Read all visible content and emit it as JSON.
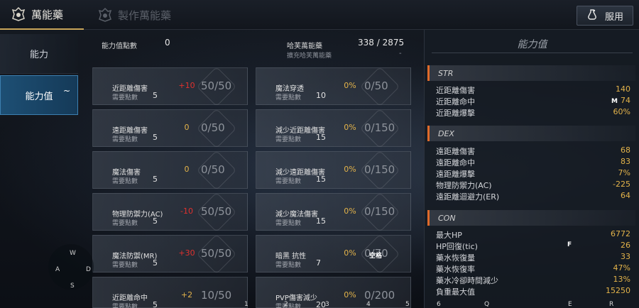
{
  "topbar": {
    "tab_active": "萬能藥",
    "tab_inactive": "製作萬能藥",
    "use_button": "服用"
  },
  "leftmenu": {
    "items": [
      {
        "label": "能力"
      },
      {
        "label": "能力值",
        "badge": "~"
      }
    ]
  },
  "header": {
    "points_label": "能力值點數",
    "points_value": "0",
    "potion_label": "哈芙萬能藥",
    "potion_value": "338 / 2875",
    "expand_label": "擴充哈芙萬能藥",
    "expand_value": "-"
  },
  "cards_left": [
    {
      "name": "近距離傷害",
      "req": "需要點數",
      "cost": "5",
      "bonus": "+10",
      "progress": "50/50"
    },
    {
      "name": "遠距離傷害",
      "req": "需要點數",
      "cost": "5",
      "bonus": "0",
      "progress": "0/50"
    },
    {
      "name": "魔法傷害",
      "req": "需要點數",
      "cost": "5",
      "bonus": "0",
      "progress": "0/50"
    },
    {
      "name": "物理防禦力(AC)",
      "req": "需要點數",
      "cost": "5",
      "bonus": "-10",
      "progress": "50/50"
    },
    {
      "name": "魔法防禦(MR)",
      "req": "需要點數",
      "cost": "5",
      "bonus": "+30",
      "progress": "50/50"
    },
    {
      "name": "近距離命中",
      "req": "需要點數",
      "cost": "5",
      "bonus": "+2",
      "progress": "10/50"
    }
  ],
  "cards_right": [
    {
      "name": "魔法穿透",
      "req": "需要點數",
      "cost": "10",
      "bonus": "0%",
      "progress": "0/50"
    },
    {
      "name": "減少近距離傷害",
      "req": "需要點數",
      "cost": "15",
      "bonus": "0%",
      "progress": "0/150"
    },
    {
      "name": "減少遠距離傷害",
      "req": "需要點數",
      "cost": "15",
      "bonus": "0%",
      "progress": "0/150"
    },
    {
      "name": "減少魔法傷害",
      "req": "需要點數",
      "cost": "15",
      "bonus": "0%",
      "progress": "0/150"
    },
    {
      "name": "暗黑 抗性",
      "req": "需要點數",
      "cost": "7",
      "bonus": "0%",
      "progress": "0/70"
    },
    {
      "name": "PVP傷害減少",
      "req": "需要點數",
      "cost": "20",
      "bonus": "0%",
      "progress": "0/200"
    }
  ],
  "stats_panel": {
    "title": "能力值",
    "sections": [
      {
        "name": "STR",
        "rows": [
          {
            "k": "近距離傷害",
            "v": "140"
          },
          {
            "k": "近距離命中",
            "v": "74"
          },
          {
            "k": "近距離爆擊",
            "v": "60%"
          }
        ]
      },
      {
        "name": "DEX",
        "rows": [
          {
            "k": "遠距離傷害",
            "v": "68"
          },
          {
            "k": "遠距離命中",
            "v": "83"
          },
          {
            "k": "遠距離爆擊",
            "v": "7%"
          },
          {
            "k": "物理防禦力(AC)",
            "v": "-225"
          },
          {
            "k": "遠距離迴避力(ER)",
            "v": "64"
          }
        ]
      },
      {
        "name": "CON",
        "rows": [
          {
            "k": "最大HP",
            "v": "6772"
          },
          {
            "k": "HP回復(tic)",
            "v": "26"
          },
          {
            "k": "藥水恢復量",
            "v": "33"
          },
          {
            "k": "藥水恢復率",
            "v": "47%"
          },
          {
            "k": "藥水冷卻時間減少",
            "v": "13%"
          },
          {
            "k": "負重最大值",
            "v": "15250"
          }
        ]
      }
    ]
  },
  "hud": {
    "w": "W",
    "a": "A",
    "s": "S",
    "d": "D",
    "hotkeys": [
      "1",
      "2",
      "3",
      "4",
      "5",
      "6",
      "Q",
      "E",
      "R"
    ],
    "space": "空格",
    "m": "M",
    "f": "F"
  }
}
